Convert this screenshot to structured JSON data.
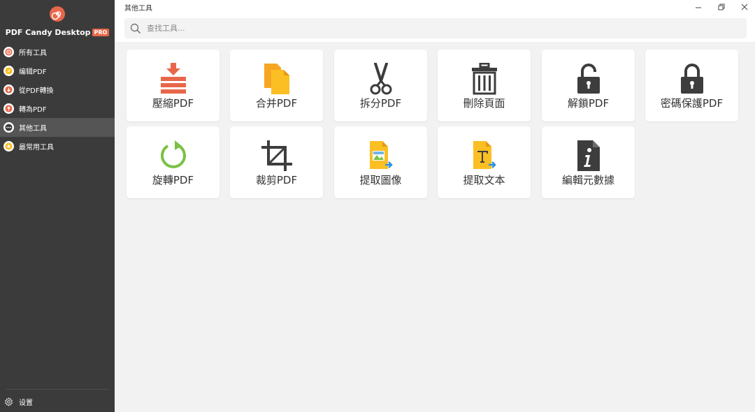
{
  "app": {
    "name": "PDF Candy Desktop",
    "badge": "PRO",
    "brand_color": "#e8674a"
  },
  "sidebar": {
    "items": [
      {
        "label": "所有工具",
        "icon": "spiral-icon",
        "active": false
      },
      {
        "label": "编辑PDF",
        "icon": "pencil-icon",
        "active": false
      },
      {
        "label": "從PDF轉換",
        "icon": "arrow-down-icon",
        "active": false
      },
      {
        "label": "轉為PDF",
        "icon": "arrow-up-icon",
        "active": false
      },
      {
        "label": "其他工具",
        "icon": "more-dots-icon",
        "active": true
      },
      {
        "label": "最常用工具",
        "icon": "star-icon",
        "active": false
      }
    ],
    "settings_label": "设置"
  },
  "window": {
    "title": "其他工具"
  },
  "search": {
    "placeholder": "查找工具..."
  },
  "tools": [
    {
      "label": "壓縮PDF",
      "icon": "compress-icon"
    },
    {
      "label": "合并PDF",
      "icon": "merge-icon"
    },
    {
      "label": "拆分PDF",
      "icon": "scissors-icon"
    },
    {
      "label": "刪除頁面",
      "icon": "trash-icon"
    },
    {
      "label": "解鎖PDF",
      "icon": "unlock-icon"
    },
    {
      "label": "密碼保護PDF",
      "icon": "lock-icon"
    },
    {
      "label": "旋轉PDF",
      "icon": "rotate-icon"
    },
    {
      "label": "裁剪PDF",
      "icon": "crop-icon"
    },
    {
      "label": "提取圖像",
      "icon": "extract-image-icon"
    },
    {
      "label": "提取文本",
      "icon": "extract-text-icon"
    },
    {
      "label": "編輯元數據",
      "icon": "metadata-icon"
    }
  ],
  "colors": {
    "sidebar_bg": "#3b3b3b",
    "sidebar_active": "#555555",
    "accent_red": "#e8674a",
    "accent_yellow": "#fbbf24",
    "accent_green": "#7ac143",
    "icon_dark": "#3d3d3d",
    "accent_blue": "#2f8fe0"
  }
}
